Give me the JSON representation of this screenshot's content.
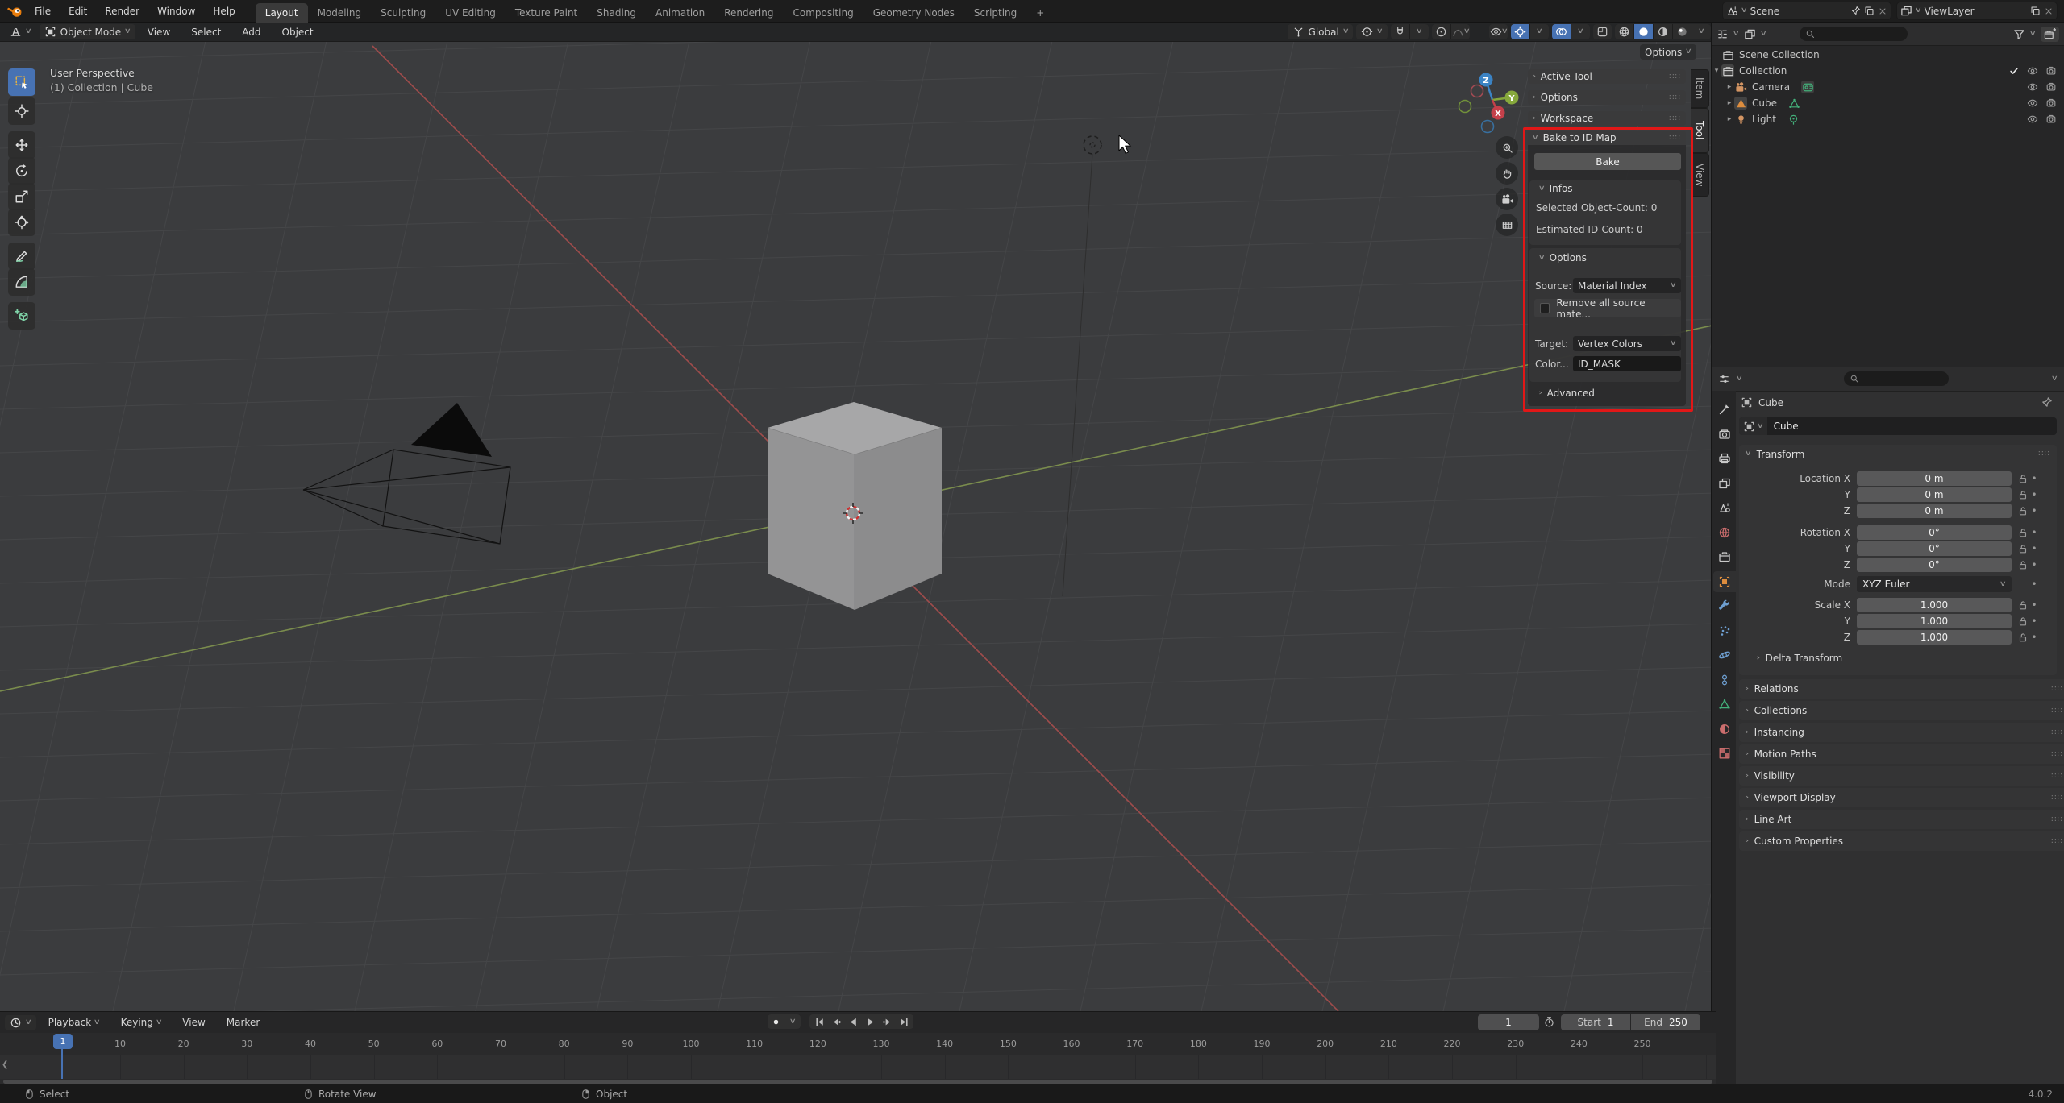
{
  "topbar": {
    "menus": [
      "File",
      "Edit",
      "Render",
      "Window",
      "Help"
    ],
    "workspaces": [
      "Layout",
      "Modeling",
      "Sculpting",
      "UV Editing",
      "Texture Paint",
      "Shading",
      "Animation",
      "Rendering",
      "Compositing",
      "Geometry Nodes",
      "Scripting"
    ],
    "active_workspace": "Layout",
    "add_workspace_label": "+",
    "scene_name": "Scene",
    "viewlayer_name": "ViewLayer"
  },
  "viewport_header": {
    "mode": "Object Mode",
    "menus": [
      "View",
      "Select",
      "Add",
      "Object"
    ],
    "orientation": "Global",
    "options_label": "Options"
  },
  "viewport": {
    "overlay_title": "User Perspective",
    "overlay_context": "(1) Collection | Cube",
    "gizmo_axes": {
      "x": "X",
      "y": "Y",
      "z": "Z"
    }
  },
  "npanel": {
    "tabs": [
      "Item",
      "Tool",
      "View"
    ],
    "active_tab": "Tool",
    "collapsed_panels": [
      "Active Tool",
      "Options",
      "Workspace"
    ],
    "bake": {
      "title": "Bake to ID Map",
      "bake_button": "Bake",
      "infos_title": "Infos",
      "selected_count": "Selected Object-Count: 0",
      "estimated_count": "Estimated ID-Count: 0",
      "options_title": "Options",
      "source_label": "Source:",
      "source_value": "Material Index",
      "remove_checkbox_label": "Remove all source mate...",
      "target_label": "Target:",
      "target_value": "Vertex Colors",
      "color_label": "Color...",
      "color_value": "ID_MASK",
      "advanced_title": "Advanced"
    }
  },
  "outliner": {
    "rows": [
      {
        "label": "Scene Collection"
      },
      {
        "label": "Collection"
      },
      {
        "label": "Camera"
      },
      {
        "label": "Cube"
      },
      {
        "label": "Light"
      }
    ]
  },
  "properties": {
    "tabs": [
      "tool",
      "render",
      "output",
      "vlayer",
      "scene",
      "world",
      "collection",
      "object",
      "modifier",
      "particles",
      "physics",
      "constraint",
      "data",
      "material",
      "texture"
    ],
    "active_tab": "object",
    "breadcrumb": "Cube",
    "name_field": "Cube",
    "transform": {
      "title": "Transform",
      "rows": [
        {
          "label": "Location X",
          "value": "0 m"
        },
        {
          "label": "Y",
          "value": "0 m"
        },
        {
          "label": "Z",
          "value": "0 m"
        },
        {
          "label": "Rotation X",
          "value": "0°"
        },
        {
          "label": "Y",
          "value": "0°"
        },
        {
          "label": "Z",
          "value": "0°"
        },
        {
          "label": "Mode",
          "value": "XYZ Euler"
        },
        {
          "label": "Scale X",
          "value": "1.000"
        },
        {
          "label": "Y",
          "value": "1.000"
        },
        {
          "label": "Z",
          "value": "1.000"
        }
      ],
      "subpanel": "Delta Transform"
    },
    "collapsed_panels": [
      "Relations",
      "Collections",
      "Instancing",
      "Motion Paths",
      "Visibility",
      "Viewport Display",
      "Line Art",
      "Custom Properties"
    ]
  },
  "timeline": {
    "menus": [
      "Playback",
      "Keying",
      "View",
      "Marker"
    ],
    "current_frame": "1",
    "start_label": "Start",
    "start_value": "1",
    "end_label": "End",
    "end_value": "250",
    "tick_step": 10,
    "tick_last": 250
  },
  "statusbar": {
    "items": [
      {
        "label": "Select"
      },
      {
        "label": "Rotate View"
      },
      {
        "label": "Object"
      }
    ],
    "version": "4.0.2"
  },
  "colors": {
    "accent_blue": "#4772b3",
    "annotation_red": "#e11717",
    "axis_x_red": "#a04c4c",
    "axis_y_green": "#7a8c4d",
    "object_orange": "#dd8d3e",
    "data_green": "#43b07a"
  }
}
